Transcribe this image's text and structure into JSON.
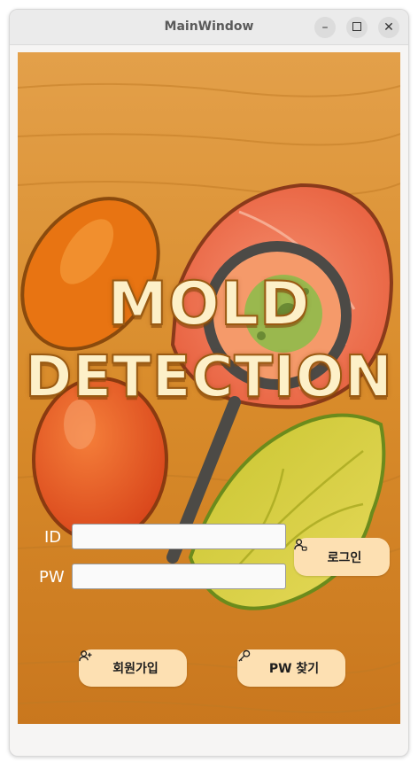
{
  "window": {
    "title": "MainWindow",
    "minimize_icon": "minimize-icon",
    "maximize_icon": "maximize-icon",
    "close_icon": "close-icon"
  },
  "hero": {
    "line1": "MOLD",
    "line2": "DETECTION"
  },
  "login": {
    "id_label": "ID",
    "pw_label": "PW",
    "id_value": "",
    "pw_value": "",
    "login_label": "로그인",
    "login_icon": "user-lock-icon"
  },
  "footer": {
    "signup_label": "회원가입",
    "signup_icon": "user-add-icon",
    "findpw_label": "PW 찾기",
    "findpw_icon": "key-icon"
  },
  "colors": {
    "background": "#d98c2b",
    "button": "#fde0b2",
    "title_text": "#fdf0c8"
  }
}
